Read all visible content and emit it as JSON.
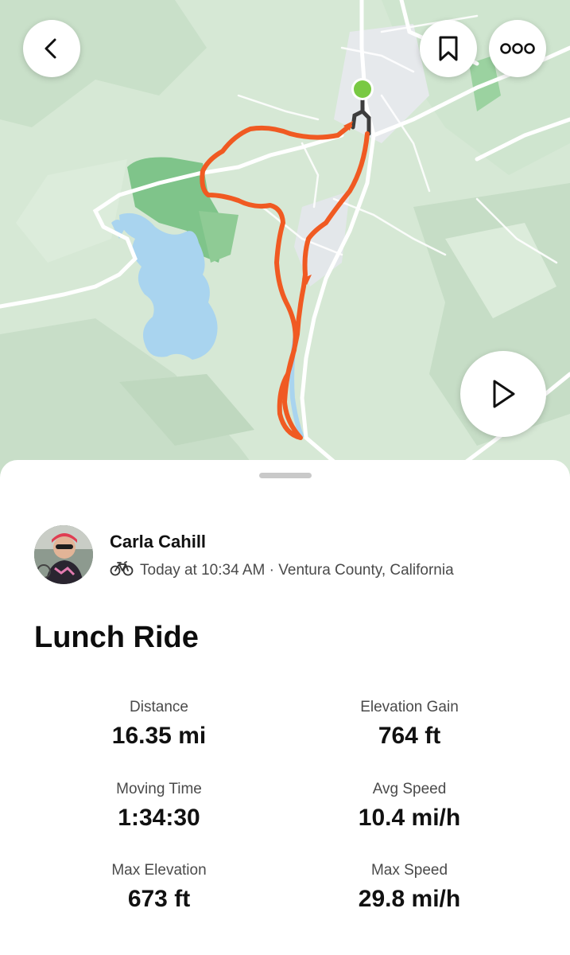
{
  "map": {
    "back_icon": "chevron-left-icon",
    "bookmark_icon": "bookmark-icon",
    "more_icon": "more-dots-icon",
    "play_icon": "play-icon",
    "colors": {
      "terrain": "#d7e9d6",
      "park": "#7fc48a",
      "water": "#a9d4ef",
      "route": "#f05a22",
      "start_marker": "#79c943"
    }
  },
  "activity": {
    "athlete_name": "Carla Cahill",
    "sport_icon": "bike-icon",
    "meta": "Today at 10:34 AM · Ventura County, California",
    "title": "Lunch Ride"
  },
  "stats": [
    {
      "label": "Distance",
      "value": "16.35 mi"
    },
    {
      "label": "Elevation Gain",
      "value": "764 ft"
    },
    {
      "label": "Moving Time",
      "value": "1:34:30"
    },
    {
      "label": "Avg Speed",
      "value": "10.4 mi/h"
    },
    {
      "label": "Max Elevation",
      "value": "673 ft"
    },
    {
      "label": "Max Speed",
      "value": "29.8 mi/h"
    }
  ]
}
